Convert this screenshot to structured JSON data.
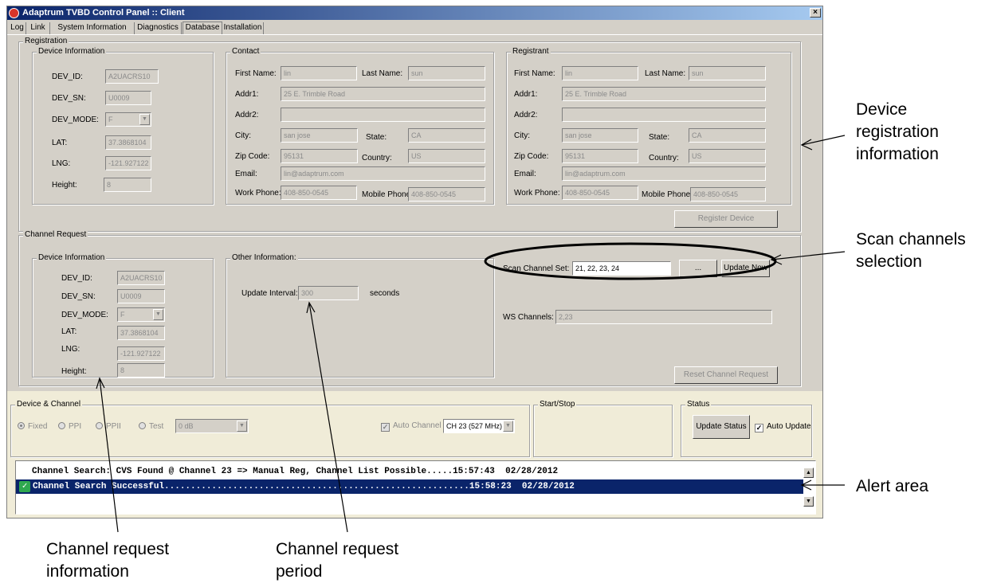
{
  "window": {
    "title": "Adaptrum TVBD Control Panel :: Client",
    "close_glyph": "×"
  },
  "tabs": [
    "Log",
    "Link",
    "System Information",
    "Diagnostics",
    "Database",
    "Installation"
  ],
  "active_tab": "Database",
  "registration": {
    "label": "Registration",
    "device": {
      "label": "Device Information",
      "dev_id_label": "DEV_ID:",
      "dev_id": "A2UACRS10",
      "dev_sn_label": "DEV_SN:",
      "dev_sn": "U0009",
      "dev_mode_label": "DEV_MODE:",
      "dev_mode": "F",
      "lat_label": "LAT:",
      "lat": "37.3868104",
      "lng_label": "LNG:",
      "lng": "-121.927122",
      "height_label": "Height:",
      "height": "8"
    },
    "contact": {
      "label": "Contact",
      "first_name_label": "First Name:",
      "first_name": "lin",
      "last_name_label": "Last Name:",
      "last_name": "sun",
      "addr1_label": "Addr1:",
      "addr1": "25 E. Trimble Road",
      "addr2_label": "Addr2:",
      "addr2": "",
      "city_label": "City:",
      "city": "san jose",
      "state_label": "State:",
      "state": "CA",
      "zip_label": "Zip Code:",
      "zip": "95131",
      "country_label": "Country:",
      "country": "US",
      "email_label": "Email:",
      "email": "lin@adaptrum.com",
      "work_phone_label": "Work Phone:",
      "work_phone": "408-850-0545",
      "mobile_phone_label": "Mobile Phone:",
      "mobile_phone": "408-850-0545"
    },
    "registrant": {
      "label": "Registrant",
      "first_name_label": "First Name:",
      "first_name": "lin",
      "last_name_label": "Last Name:",
      "last_name": "sun",
      "addr1_label": "Addr1:",
      "addr1": "25 E. Trimble Road",
      "addr2_label": "Addr2:",
      "addr2": "",
      "city_label": "City:",
      "city": "san jose",
      "state_label": "State:",
      "state": "CA",
      "zip_label": "Zip Code:",
      "zip": "95131",
      "country_label": "Country:",
      "country": "US",
      "email_label": "Email:",
      "email": "lin@adaptrum.com",
      "work_phone_label": "Work Phone:",
      "work_phone": "408-850-0545",
      "mobile_phone_label": "Mobile Phone:",
      "mobile_phone": "408-850-0545"
    },
    "register_button": "Register Device"
  },
  "channel_request": {
    "label": "Channel Request",
    "device": {
      "label": "Device Information",
      "dev_id_label": "DEV_ID:",
      "dev_id": "A2UACRS10",
      "dev_sn_label": "DEV_SN:",
      "dev_sn": "U0009",
      "dev_mode_label": "DEV_MODE:",
      "dev_mode": "F",
      "lat_label": "LAT:",
      "lat": "37.3868104",
      "lng_label": "LNG:",
      "lng": "-121.927122",
      "height_label": "Height:",
      "height": "8"
    },
    "other": {
      "label": "Other Information:",
      "update_interval_label": "Update Interval:",
      "update_interval": "300",
      "unit": "seconds"
    },
    "scan_label": "Scan Channel Set:",
    "scan_value": "21, 22, 23, 24",
    "browse_button": "...",
    "update_now_button": "Update Now",
    "ws_label": "WS Channels:",
    "ws_value": "2,23",
    "reset_button": "Reset Channel Request"
  },
  "device_channel": {
    "label": "Device & Channel",
    "radios": [
      "Fixed",
      "PPI",
      "PPII",
      "Test"
    ],
    "selected_radio": "Fixed",
    "test_value": "0 dB",
    "auto_channel_label": "Auto Channel",
    "channel_value": "CH 23 (527 MHz)"
  },
  "start_stop": {
    "label": "Start/Stop"
  },
  "status": {
    "label": "Status",
    "update_button": "Update Status",
    "auto_update_label": "Auto Update"
  },
  "alerts": [
    {
      "text": "Channel Search: CVS Found @ Channel 23 => Manual Reg, Channel List Possible.....15:57:43  02/28/2012",
      "selected": false
    },
    {
      "text": "Channel Search Successful..........................................................15:58:23  02/28/2012",
      "selected": true
    }
  ],
  "annotations": {
    "device_registration": [
      "Device",
      "registration",
      "information"
    ],
    "scan_channels": [
      "Scan channels",
      "selection"
    ],
    "alert_area": [
      "Alert area"
    ],
    "channel_request_info": [
      "Channel request",
      "information"
    ],
    "channel_request_period": [
      "Channel request",
      "period"
    ]
  }
}
